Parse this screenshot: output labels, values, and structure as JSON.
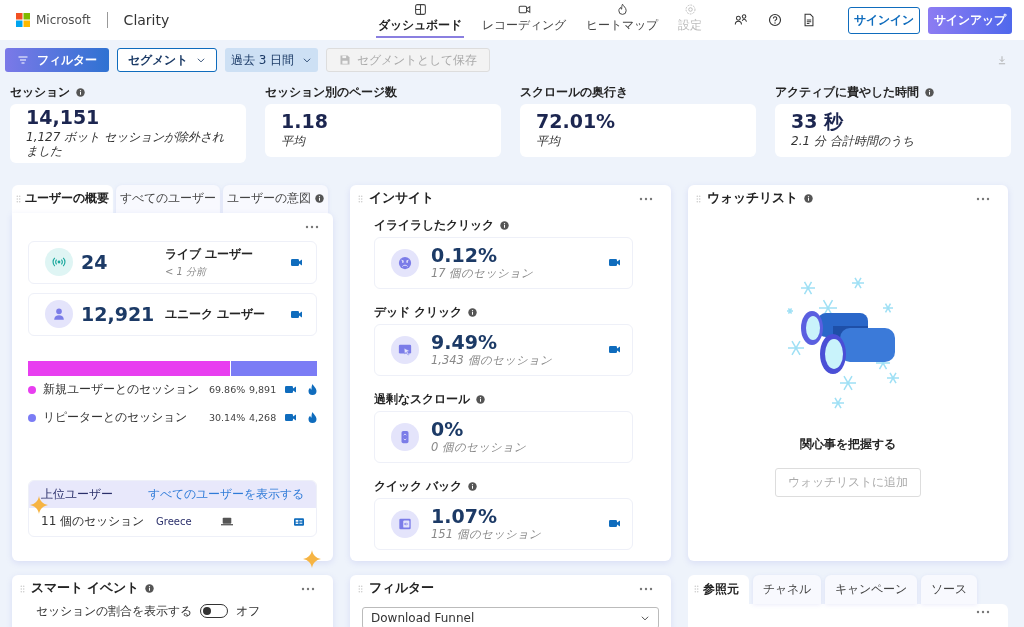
{
  "header": {
    "brand": "Microsoft",
    "product": "Clarity",
    "nav": [
      {
        "label": "ダッシュボード",
        "selected": true,
        "disabled": false
      },
      {
        "label": "レコーディング",
        "selected": false,
        "disabled": false
      },
      {
        "label": "ヒートマップ",
        "selected": false,
        "disabled": false
      },
      {
        "label": "設定",
        "selected": false,
        "disabled": true
      }
    ],
    "sign_in": "サインイン",
    "sign_up": "サインアップ"
  },
  "toolbar": {
    "filter": "フィルター",
    "segment": "セグメント",
    "date_range": "過去 3 日間",
    "save": {
      "label": "セグメントとして保存",
      "disabled": true
    }
  },
  "metrics": [
    {
      "label": "セッション",
      "info": true,
      "value": "14,151",
      "note": "1,127 ボット セッションが除外されました"
    },
    {
      "label": "セッション別のページ数",
      "info": false,
      "value": "1.18",
      "note": "平均"
    },
    {
      "label": "スクロールの奥行き",
      "info": false,
      "value": "72.01%",
      "note": "平均"
    },
    {
      "label": "アクティブに費やした時間",
      "info": true,
      "value": "33 秒",
      "note": "2.1 分 合計時間のうち"
    }
  ],
  "user_overview": {
    "tabs": [
      {
        "label": "ユーザーの概要",
        "selected": true,
        "info": false
      },
      {
        "label": "すべてのユーザー",
        "selected": false,
        "info": false
      },
      {
        "label": "ユーザーの意図",
        "selected": false,
        "info": true
      }
    ],
    "live": {
      "value": "24",
      "label": "ライブ ユーザー",
      "note": "< 1 分前"
    },
    "unique": {
      "value": "12,921",
      "label": "ユニーク ユーザー"
    },
    "segments": [
      {
        "label": "新規ユーザーとのセッション",
        "percent": "69.86%",
        "count": "9,891",
        "color": "#e83ef0",
        "level": 0.6986
      },
      {
        "label": "リピーターとのセッション",
        "percent": "30.14%",
        "count": "4,268",
        "color": "#7b7cf5",
        "level": 0.3014
      }
    ],
    "top_users": {
      "title": "上位ユーザー",
      "link": "すべてのユーザーを表示する",
      "row": {
        "sessions": "11 個のセッション",
        "country": "Greece"
      }
    }
  },
  "insights": {
    "title": "インサイト",
    "items": [
      {
        "label": "イライラしたクリック",
        "value": "0.12%",
        "note": "17 個のセッション",
        "kind": "rage",
        "recording": true
      },
      {
        "label": "デッド クリック",
        "value": "9.49%",
        "note": "1,343 個のセッション",
        "kind": "dead",
        "recording": true
      },
      {
        "label": "過剰なスクロール",
        "value": "0%",
        "note": "0 個のセッション",
        "kind": "scroll",
        "recording": false
      },
      {
        "label": "クイック バック",
        "value": "1.07%",
        "note": "151 個のセッション",
        "kind": "back",
        "recording": true
      }
    ]
  },
  "watchlist": {
    "title": "ウォッチリスト",
    "message": "関心事を把握する",
    "button": {
      "label": "ウォッチリストに追加",
      "disabled": true
    }
  },
  "smart_events": {
    "title": "スマート イベント",
    "toggle": {
      "label": "セッションの割合を表示する",
      "on": false,
      "state_text": "オフ"
    }
  },
  "filter_panel": {
    "title": "フィルター",
    "select": "Download Funnel"
  },
  "referrers": {
    "tabs": [
      {
        "label": "参照元",
        "selected": true
      },
      {
        "label": "チャネル",
        "selected": false
      },
      {
        "label": "キャンペーン",
        "selected": false
      },
      {
        "label": "ソース",
        "selected": false
      }
    ]
  }
}
